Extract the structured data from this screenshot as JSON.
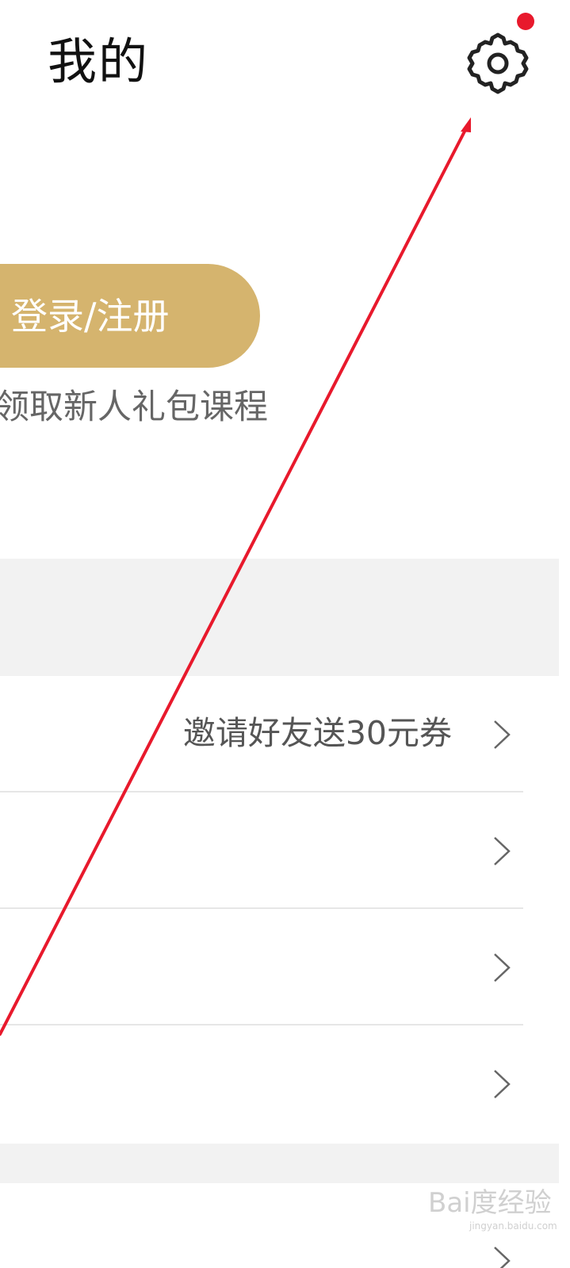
{
  "header": {
    "title": "我的",
    "settings_icon": "gear-icon",
    "notification_dot_color": "#e8192c"
  },
  "account": {
    "login_label": "登录/注册",
    "login_button_color": "#d5b46e",
    "promo_text": "领取新人礼包课程"
  },
  "menu": {
    "rows": [
      {
        "value": "邀请好友送30元券",
        "chevron_icon": "chevron-right-icon"
      },
      {
        "value": "",
        "chevron_icon": "chevron-right-icon"
      },
      {
        "value": "",
        "chevron_icon": "chevron-right-icon"
      },
      {
        "value": "",
        "chevron_icon": "chevron-right-icon"
      },
      {
        "value": "",
        "chevron_icon": "chevron-right-icon"
      }
    ]
  },
  "annotation": {
    "arrow_color": "#e8192c"
  },
  "watermark": {
    "brand": "Bai度经验",
    "url": "jingyan.baidu.com"
  }
}
